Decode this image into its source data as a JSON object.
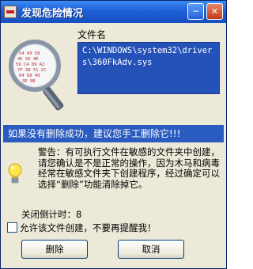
{
  "window": {
    "title": "发现危险情况",
    "min_label": "─",
    "close_label": "✕"
  },
  "file": {
    "label": "文件名",
    "path": "C:\\WINDOWS\\system32\\drivers\\360FkAdv.sys"
  },
  "warning_bar": "如果没有删除成功，建议您手工删除它!!!",
  "notice": "警告：有可执行文件在敏感的文件夹中创建，请您确认是不是正常的操作，因为木马和病毒经常在敏感文件夹下创建程序，经过确定可以选择“删除”功能清除掉它。",
  "countdown": "关闭倒计时：8",
  "allow_checkbox": {
    "label": "允许该文件创建，不要再提醒我！",
    "checked": false
  },
  "buttons": {
    "delete": "删除",
    "cancel": "取消"
  },
  "colors": {
    "title_bar": "#1d5fd6",
    "path_box": "#2452b8",
    "warning_bar": "#2a5bc0",
    "window_face": "#ece9d8"
  },
  "icons": [
    "app-icon",
    "magnifier-virus-icon",
    "lightbulb-icon"
  ]
}
